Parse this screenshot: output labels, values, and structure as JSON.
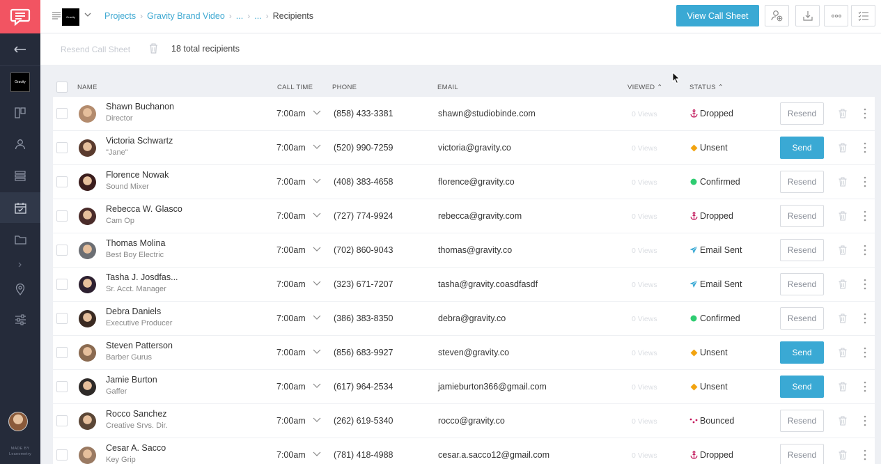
{
  "app": {
    "project_thumb_text": "Gravity",
    "made_by": "MADE BY",
    "made_by_brand": "Leanometry"
  },
  "breadcrumb": [
    {
      "label": "Projects"
    },
    {
      "label": "Gravity Brand Video"
    },
    {
      "label": "..."
    },
    {
      "label": "..."
    },
    {
      "label": "Recipients"
    }
  ],
  "toolbar": {
    "view_call_sheet": "View Call Sheet",
    "resend_call_sheet": "Resend Call Sheet",
    "total_recipients": "18 total recipients"
  },
  "table": {
    "headers": {
      "name": "NAME",
      "call_time": "CALL TIME",
      "phone": "PHONE",
      "email": "EMAIL",
      "viewed": "VIEWED ⌃",
      "status": "STATUS ⌃"
    },
    "rows": [
      {
        "name": "Shawn Buchanon",
        "role": "Director",
        "call_time": "7:00am",
        "phone": "(858) 433-3381",
        "email": "shawn@studiobinde.com",
        "views": "0 Views",
        "status": "Dropped",
        "status_icon": "anchor-icon",
        "status_color": "#c2185b",
        "action": "Resend",
        "avatar_color": "#b38b6d"
      },
      {
        "name": "Victoria Schwartz",
        "role": "\"Jane\"",
        "call_time": "7:00am",
        "phone": "(520) 990-7259",
        "email": "victoria@gravity.co",
        "views": "0 Views",
        "status": "Unsent",
        "status_icon": "diamond-icon",
        "status_color": "#f2a30f",
        "action": "Send",
        "avatar_color": "#5a3b2e"
      },
      {
        "name": "Florence Nowak",
        "role": "Sound Mixer",
        "call_time": "7:00am",
        "phone": "(408) 383-4658",
        "email": "florence@gravity.co",
        "views": "0 Views",
        "status": "Confirmed",
        "status_icon": "circle-icon",
        "status_color": "#2ecc71",
        "action": "Resend",
        "avatar_color": "#3b1d1d"
      },
      {
        "name": "Rebecca W. Glasco",
        "role": "Cam Op",
        "call_time": "7:00am",
        "phone": "(727) 774-9924",
        "email": "rebecca@gravity.com",
        "views": "0 Views",
        "status": "Dropped",
        "status_icon": "anchor-icon",
        "status_color": "#c2185b",
        "action": "Resend",
        "avatar_color": "#4a2c2a"
      },
      {
        "name": "Thomas Molina",
        "role": "Best Boy Electric",
        "call_time": "7:00am",
        "phone": "(702) 860-9043",
        "email": "thomas@gravity.co",
        "views": "0 Views",
        "status": "Email Sent",
        "status_icon": "paper-plane-icon",
        "status_color": "#3aa9d4",
        "action": "Resend",
        "avatar_color": "#6b6e73"
      },
      {
        "name": "Tasha J. Josdfas...",
        "role": "Sr. Acct. Manager",
        "call_time": "7:00am",
        "phone": "(323) 671-7207",
        "email": "tasha@gravity.coasdfasdf",
        "views": "0 Views",
        "status": "Email Sent",
        "status_icon": "paper-plane-icon",
        "status_color": "#3aa9d4",
        "action": "Resend",
        "avatar_color": "#2d2030"
      },
      {
        "name": "Debra Daniels",
        "role": "Executive Producer",
        "call_time": "7:00am",
        "phone": "(386) 383-8350",
        "email": "debra@gravity.co",
        "views": "0 Views",
        "status": "Confirmed",
        "status_icon": "circle-icon",
        "status_color": "#2ecc71",
        "action": "Resend",
        "avatar_color": "#3a2a22"
      },
      {
        "name": "Steven Patterson",
        "role": "Barber Gurus",
        "call_time": "7:00am",
        "phone": "(856) 683-9927",
        "email": "steven@gravity.co",
        "views": "0 Views",
        "status": "Unsent",
        "status_icon": "diamond-icon",
        "status_color": "#f2a30f",
        "action": "Send",
        "avatar_color": "#8a6a50"
      },
      {
        "name": "Jamie Burton",
        "role": "Gaffer",
        "call_time": "7:00am",
        "phone": "(617) 964-2534",
        "email": "jamieburton366@gmail.com",
        "views": "0 Views",
        "status": "Unsent",
        "status_icon": "diamond-icon",
        "status_color": "#f2a30f",
        "action": "Send",
        "avatar_color": "#2e2a28"
      },
      {
        "name": "Rocco Sanchez",
        "role": "Creative Srvs. Dir.",
        "call_time": "7:00am",
        "phone": "(262) 619-5340",
        "email": "rocco@gravity.co",
        "views": "0 Views",
        "status": "Bounced",
        "status_icon": "bounce-icon",
        "status_color": "#c2185b",
        "action": "Resend",
        "avatar_color": "#5b4636"
      },
      {
        "name": "Cesar A. Sacco",
        "role": "Key Grip",
        "call_time": "7:00am",
        "phone": "(781) 418-4988",
        "email": "cesar.a.sacco12@gmail.com",
        "views": "0 Views",
        "status": "Dropped",
        "status_icon": "anchor-icon",
        "status_color": "#c2185b",
        "action": "Resend",
        "avatar_color": "#9a7a62"
      }
    ]
  }
}
